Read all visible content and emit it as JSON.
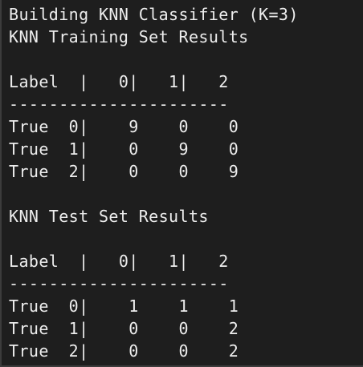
{
  "terminal": {
    "lines": [
      "Building KNN Classifier (K=3)",
      "KNN Training Set Results",
      "",
      "Label  |   0|   1|   2",
      "----------------------",
      "True  0|    9    0    0",
      "True  1|    0    9    0",
      "True  2|    0    0    9",
      "",
      "KNN Test Set Results",
      "",
      "Label  |   0|   1|   2",
      "----------------------",
      "True  0|    1    1    1",
      "True  1|    0    0    2",
      "True  2|    0    0    2"
    ]
  },
  "colors": {
    "background": "#1e1e1e",
    "text": "#ededed"
  }
}
